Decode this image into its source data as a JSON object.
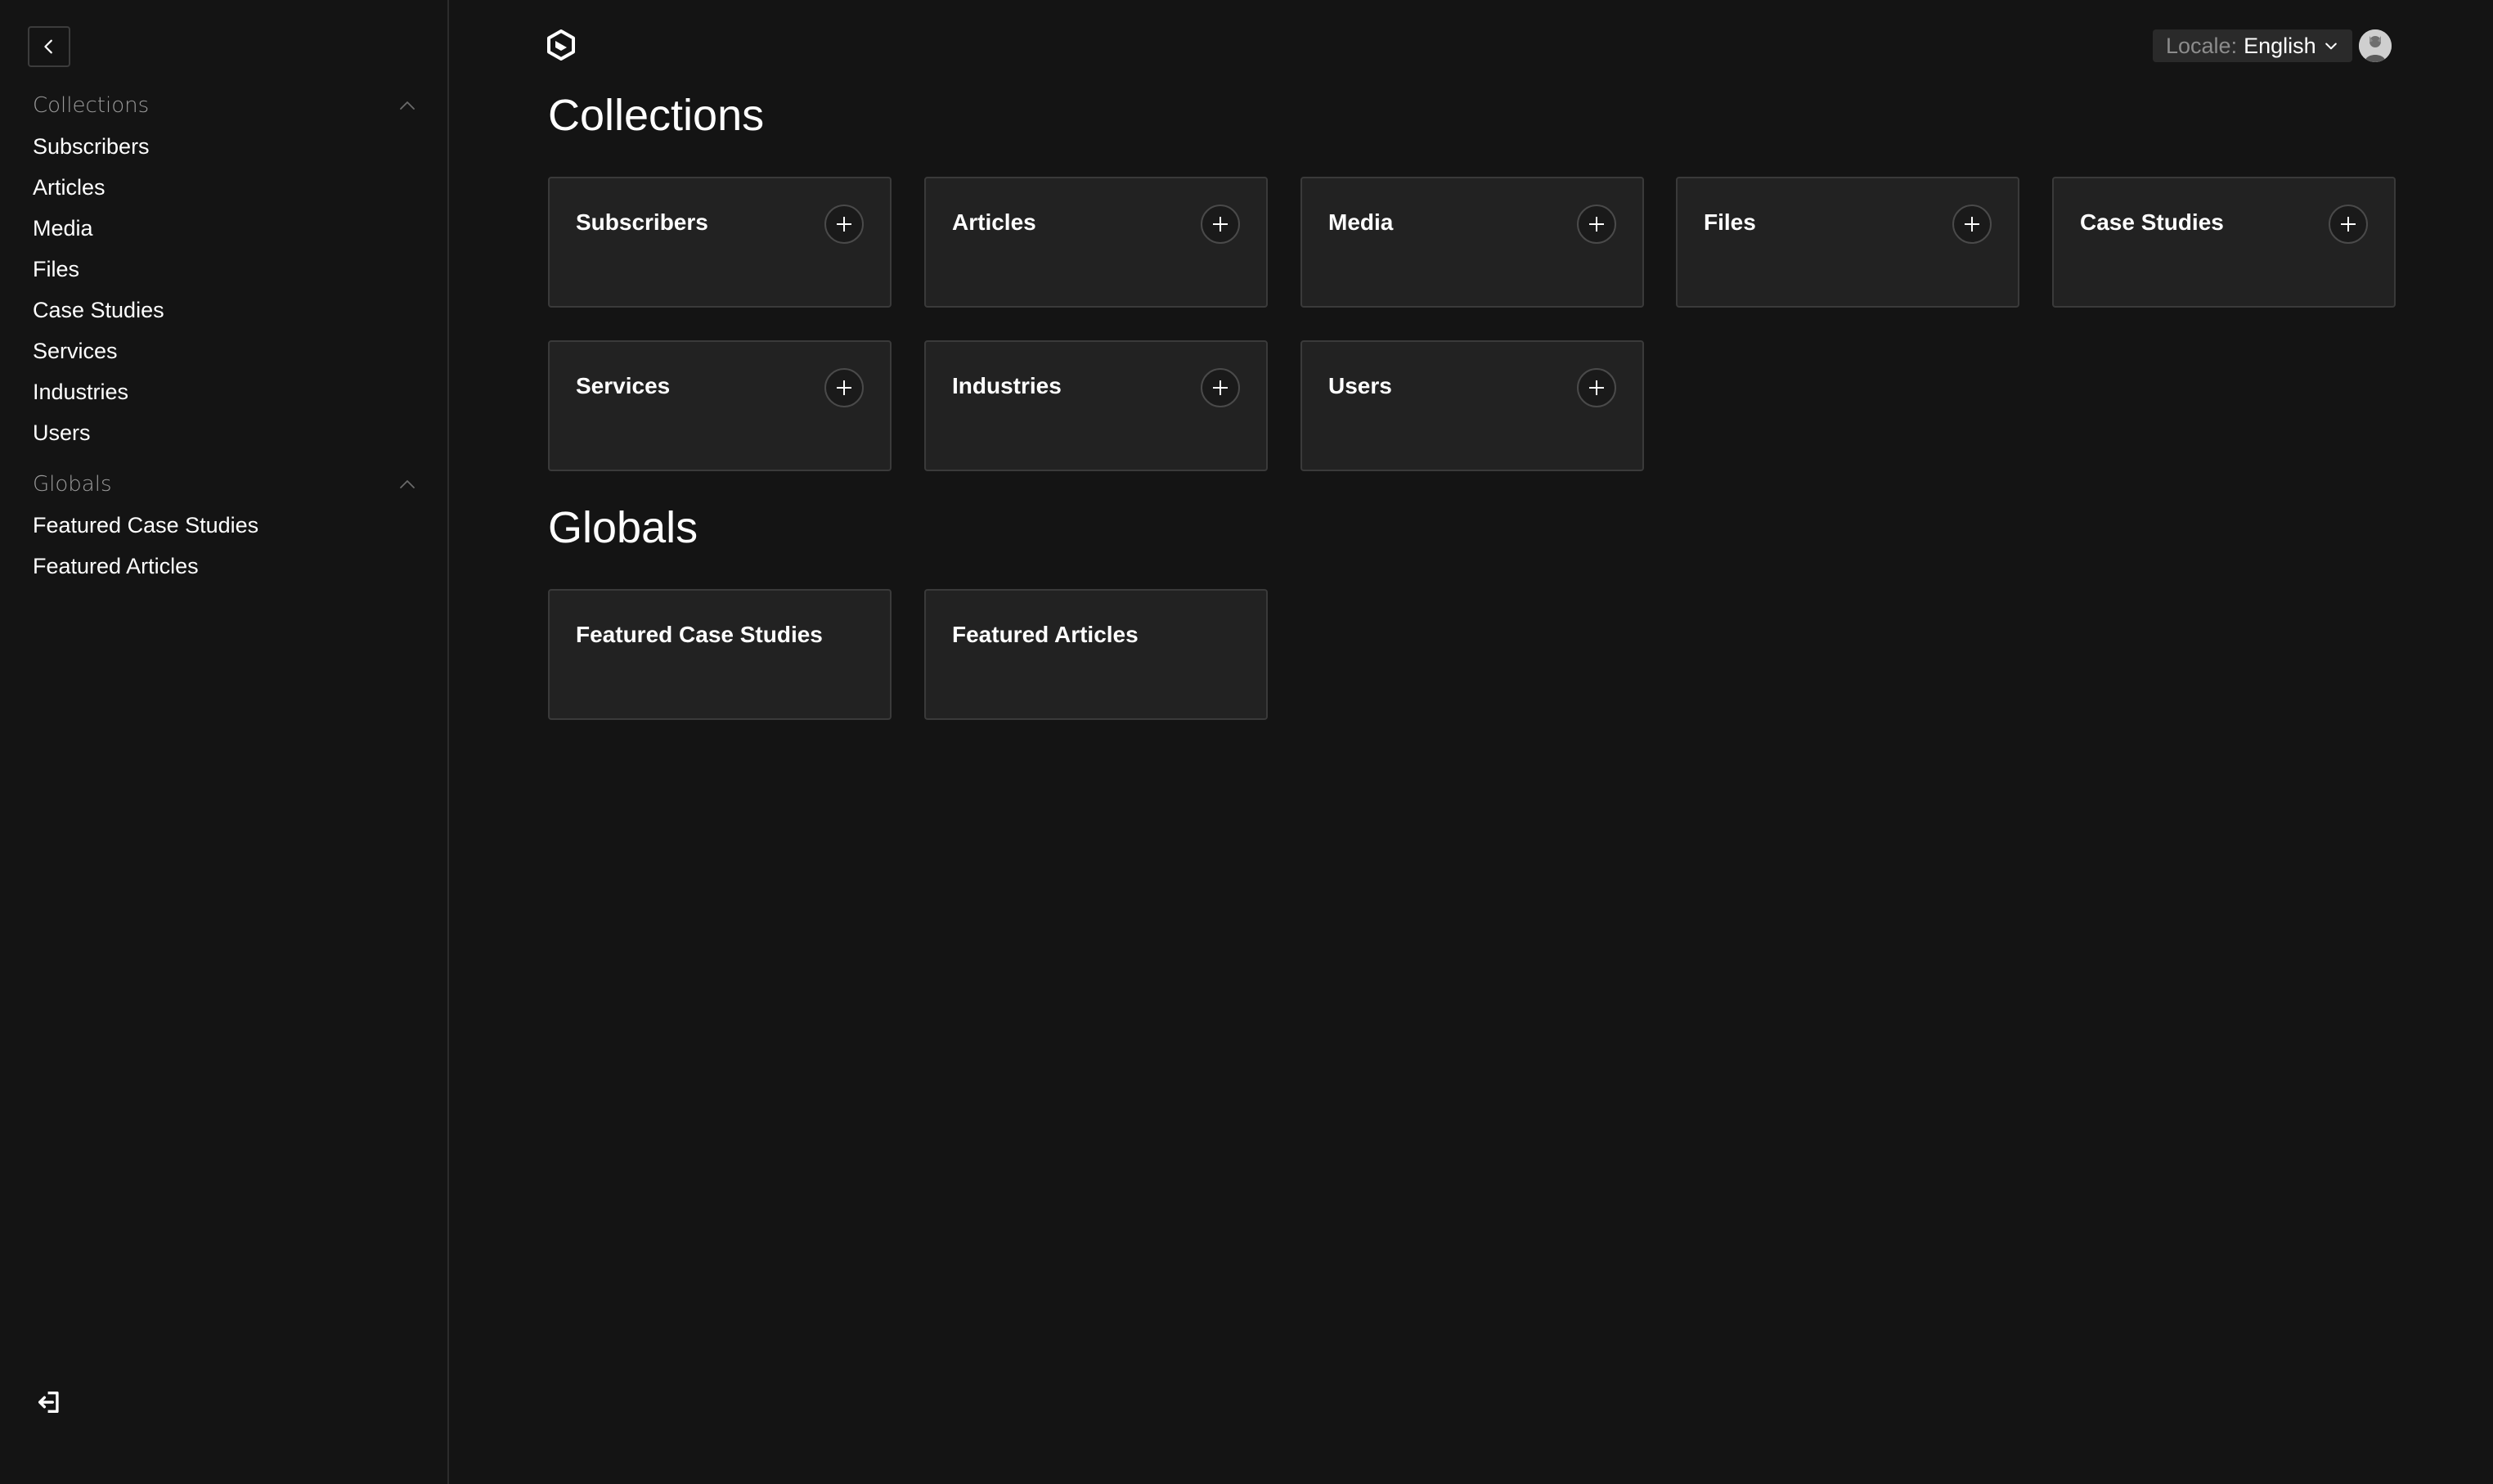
{
  "sidebar": {
    "collapse_icon": "chevron-left-icon",
    "groups": [
      {
        "label": "Collections",
        "toggle_icon": "chevron-up-icon",
        "items": [
          "Subscribers",
          "Articles",
          "Media",
          "Files",
          "Case Studies",
          "Services",
          "Industries",
          "Users"
        ]
      },
      {
        "label": "Globals",
        "toggle_icon": "chevron-up-icon",
        "items": [
          "Featured Case Studies",
          "Featured Articles"
        ]
      }
    ],
    "logout_icon": "logout-icon"
  },
  "header": {
    "logo_icon": "payload-logo-icon",
    "locale_label": "Locale:",
    "locale_value": "English",
    "locale_icon": "chevron-down-icon",
    "avatar_icon": "user-avatar-icon"
  },
  "main": {
    "collections_title": "Collections",
    "collections": [
      {
        "label": "Subscribers",
        "add_icon": "plus-icon"
      },
      {
        "label": "Articles",
        "add_icon": "plus-icon"
      },
      {
        "label": "Media",
        "add_icon": "plus-icon"
      },
      {
        "label": "Files",
        "add_icon": "plus-icon"
      },
      {
        "label": "Case Studies",
        "add_icon": "plus-icon"
      },
      {
        "label": "Services",
        "add_icon": "plus-icon"
      },
      {
        "label": "Industries",
        "add_icon": "plus-icon"
      },
      {
        "label": "Users",
        "add_icon": "plus-icon"
      }
    ],
    "globals_title": "Globals",
    "globals": [
      {
        "label": "Featured Case Studies"
      },
      {
        "label": "Featured Articles"
      }
    ]
  },
  "colors": {
    "background": "#141414",
    "card_background": "#222222",
    "card_border": "#3a3a3a",
    "text": "#ffffff",
    "muted_text": "#9a9a9a"
  }
}
